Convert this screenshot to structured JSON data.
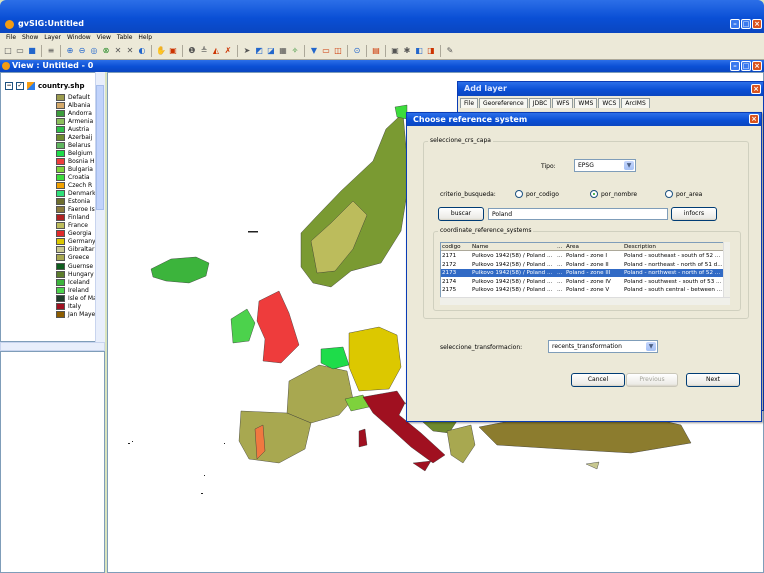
{
  "app": {
    "title": "gvSIG:Untitled",
    "menus": [
      "File",
      "Show",
      "Layer",
      "Window",
      "View",
      "Table",
      "Help"
    ]
  },
  "view": {
    "title": "View : Untitled - 0"
  },
  "toc": {
    "layer_name": "country.shp",
    "legend": [
      {
        "label": "Default",
        "color": "#9c9c4e"
      },
      {
        "label": "Albania",
        "color": "#d4a96a"
      },
      {
        "label": "Andorra",
        "color": "#3c9c3c"
      },
      {
        "label": "Armenia",
        "color": "#8cbf5c"
      },
      {
        "label": "Austria",
        "color": "#2ebf4a"
      },
      {
        "label": "Azerbaij",
        "color": "#6e8a2e"
      },
      {
        "label": "Belarus",
        "color": "#5fb55f"
      },
      {
        "label": "Belgium",
        "color": "#1edc4a"
      },
      {
        "label": "Bosnia H",
        "color": "#ee3c3c"
      },
      {
        "label": "Bulgaria",
        "color": "#7ed23c"
      },
      {
        "label": "Croatia",
        "color": "#3cdc3c"
      },
      {
        "label": "Czech R",
        "color": "#f0a000"
      },
      {
        "label": "Denmark",
        "color": "#2ee07a"
      },
      {
        "label": "Estonia",
        "color": "#6e6e2e"
      },
      {
        "label": "Faeroe Is",
        "color": "#8a7a3c"
      },
      {
        "label": "Finland",
        "color": "#b22222"
      },
      {
        "label": "France",
        "color": "#bcbc5c"
      },
      {
        "label": "Georgia",
        "color": "#e02a2a"
      },
      {
        "label": "Germany",
        "color": "#dcc800"
      },
      {
        "label": "Gibraltar",
        "color": "#c8c890"
      },
      {
        "label": "Greece",
        "color": "#a8a850"
      },
      {
        "label": "Guernse",
        "color": "#0e5e1e"
      },
      {
        "label": "Hungary",
        "color": "#5c7c2c"
      },
      {
        "label": "Iceland",
        "color": "#3cb43c"
      },
      {
        "label": "Ireland",
        "color": "#4cd24c"
      },
      {
        "label": "Isle of Ma",
        "color": "#1e3c2a"
      },
      {
        "label": "Italy",
        "color": "#a01020"
      },
      {
        "label": "Jan Mayen",
        "color": "#8c5c00"
      }
    ]
  },
  "add_layer": {
    "title": "Add layer",
    "tabs": [
      "File",
      "Georeference",
      "JDBC",
      "WFS",
      "WMS",
      "WCS",
      "ArcIMS"
    ]
  },
  "crs_dialog": {
    "title": "Choose reference system",
    "group_label": "seleccione_crs_capa",
    "tipo_label": "Tipo:",
    "tipo_value": "EPSG",
    "criterio_label": "criterio_busqueda:",
    "radio_codigo": "por_codigo",
    "radio_nombre": "por_nombre",
    "radio_area": "por_area",
    "search_button": "buscar",
    "search_value": "Poland",
    "info_button": "infocrs",
    "table_group_label": "coordinate_reference_systems",
    "columns": [
      "codigo",
      "Name",
      "...",
      "Area",
      "Description"
    ],
    "rows": [
      [
        "2171",
        "Pulkovo 1942(58) / Poland ...",
        "...",
        "Poland - zone I",
        "Poland - southeast - south of 52 ..."
      ],
      [
        "2172",
        "Pulkovo 1942(58) / Poland ...",
        "...",
        "Poland - zone II",
        "Poland - northeast - north of 51 d..."
      ],
      [
        "2173",
        "Pulkovo 1942(58) / Poland ...",
        "...",
        "Poland - zone III",
        "Poland - northwest - north of 52 ..."
      ],
      [
        "2174",
        "Pulkovo 1942(58) / Poland ...",
        "...",
        "Poland - zone IV",
        "Poland - southwest - south of 53 ..."
      ],
      [
        "2175",
        "Pulkovo 1942(58) / Poland ...",
        "...",
        "Poland - zone V",
        "Poland - south central - between ..."
      ]
    ],
    "selected_row": 2,
    "transform_label": "seleccione_transformacion:",
    "transform_value": "recents_transformation",
    "cancel_button": "Cancel",
    "previous_button": "Previous",
    "next_button": "Next"
  }
}
